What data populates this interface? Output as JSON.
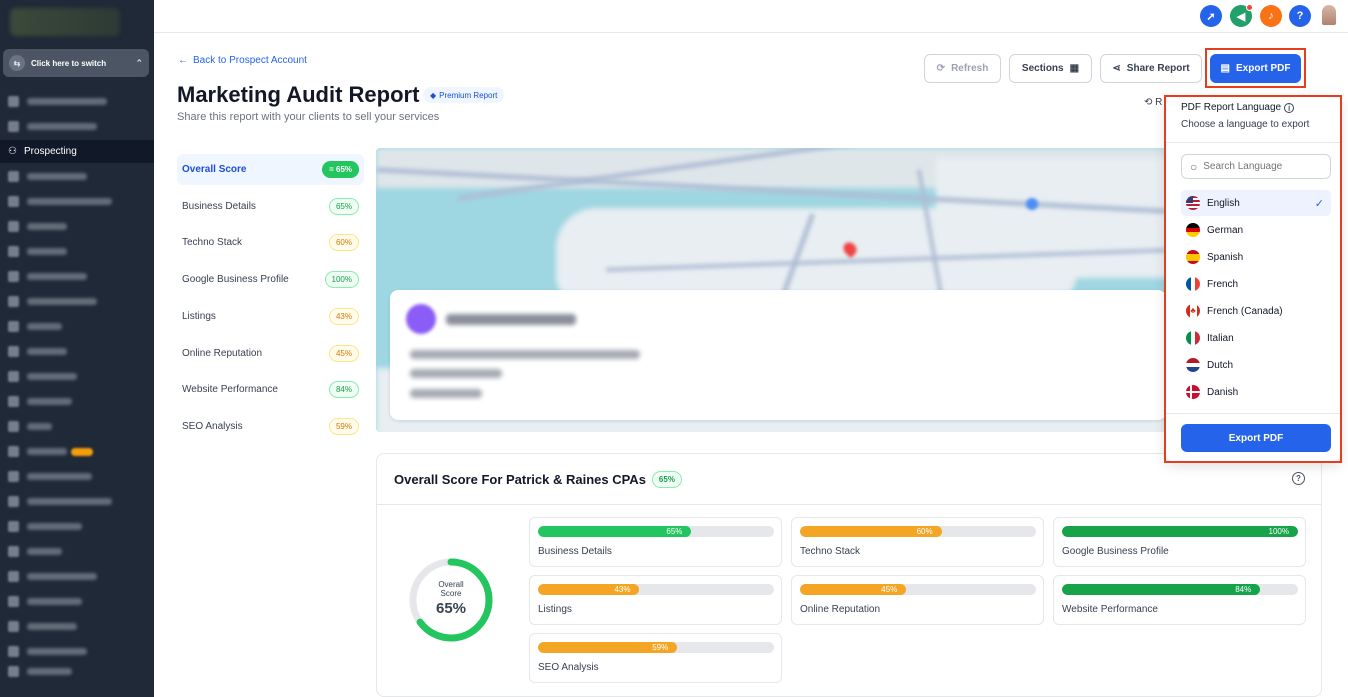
{
  "sidebar": {
    "switcher_label": "Click here to switch",
    "active_item": "Prospecting"
  },
  "header": {
    "back_link": "Back to Prospect Account",
    "title": "Marketing Audit Report",
    "premium_badge": "Premium Report",
    "subtitle": "Share this report with your clients to sell your services"
  },
  "toolbar": {
    "refresh_label": "Refresh",
    "sections_label": "Sections",
    "share_label": "Share Report",
    "export_label": "Export PDF"
  },
  "score_nav": [
    {
      "label": "Overall Score",
      "score": "= 65%"
    },
    {
      "label": "Business Details",
      "score": "65%"
    },
    {
      "label": "Techno Stack",
      "score": "60%"
    },
    {
      "label": "Google Business Profile",
      "score": "100%"
    },
    {
      "label": "Listings",
      "score": "43%"
    },
    {
      "label": "Online Reputation",
      "score": "45%"
    },
    {
      "label": "Website Performance",
      "score": "84%"
    },
    {
      "label": "SEO Analysis",
      "score": "59%"
    }
  ],
  "overall": {
    "title": "Overall Score For Patrick & Raines CPAs",
    "badge": "65%",
    "ring_label": "Overall Score",
    "ring_value": "65%",
    "ring_fraction": 0.65
  },
  "metrics": [
    {
      "label": "Business Details",
      "value": "65%",
      "fraction": 0.65,
      "color": "#22c55e"
    },
    {
      "label": "Techno Stack",
      "value": "60%",
      "fraction": 0.6,
      "color": "#f5a524"
    },
    {
      "label": "Google Business Profile",
      "value": "100%",
      "fraction": 1.0,
      "color": "#16a34a"
    },
    {
      "label": "Listings",
      "value": "43%",
      "fraction": 0.43,
      "color": "#f5a524"
    },
    {
      "label": "Online Reputation",
      "value": "45%",
      "fraction": 0.45,
      "color": "#f5a524"
    },
    {
      "label": "Website Performance",
      "value": "84%",
      "fraction": 0.84,
      "color": "#16a34a"
    },
    {
      "label": "SEO Analysis",
      "value": "59%",
      "fraction": 0.59,
      "color": "#f5a524"
    }
  ],
  "dropdown": {
    "title": "PDF Report Language",
    "subtitle": "Choose a language to export",
    "search_placeholder": "Search Language",
    "languages": [
      "English",
      "German",
      "Spanish",
      "French",
      "French (Canada)",
      "Italian",
      "Dutch",
      "Danish"
    ],
    "selected": "English",
    "export_label": "Export PDF"
  },
  "colors": {
    "accent": "#2563eb",
    "highlight": "#e53e1f",
    "good": "#22c55e",
    "warn": "#f5a524"
  }
}
